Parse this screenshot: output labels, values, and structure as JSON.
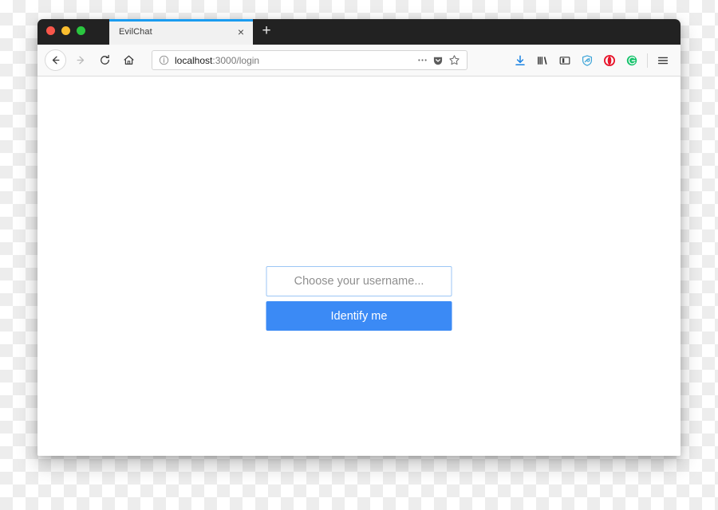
{
  "window": {
    "traffic_lights": [
      {
        "name": "close",
        "color": "#f9564a"
      },
      {
        "name": "minimize",
        "color": "#fbbe2f"
      },
      {
        "name": "maximize",
        "color": "#2ac63f"
      }
    ]
  },
  "tabs": {
    "active": {
      "title": "EvilChat",
      "close_label": "×",
      "accent_color": "#1a9cf0"
    },
    "new_tab_label": "+"
  },
  "navigation": {
    "back_icon": "arrow-left-icon",
    "forward_icon": "arrow-right-icon",
    "reload_icon": "reload-icon",
    "home_icon": "home-icon"
  },
  "url_bar": {
    "identity_icon": "info-icon",
    "host": "localhost",
    "path": ":3000/login",
    "full_url": "localhost:3000/login",
    "actions": [
      {
        "name": "page-actions-icon",
        "label": "···"
      },
      {
        "name": "pocket-icon",
        "label": ""
      },
      {
        "name": "bookmark-star-icon",
        "label": ""
      }
    ]
  },
  "toolbar_icons": [
    {
      "name": "downloads-icon",
      "color": "#1a82e2"
    },
    {
      "name": "library-icon",
      "color": "#3a3a3a"
    },
    {
      "name": "sidebar-icon",
      "color": "#3a3a3a"
    },
    {
      "name": "shield-extension-icon",
      "color": "#3aa3d8"
    },
    {
      "name": "opera-extension-icon",
      "color": "#e8142a"
    },
    {
      "name": "grammarly-extension-icon",
      "color": "#15c26b"
    },
    {
      "name": "app-menu-icon",
      "color": "#3a3a3a"
    }
  ],
  "page": {
    "form": {
      "username_placeholder": "Choose your username...",
      "username_value": "",
      "submit_label": "Identify me",
      "button_color": "#3b8af5",
      "input_border_color": "#9cc6f5"
    }
  }
}
